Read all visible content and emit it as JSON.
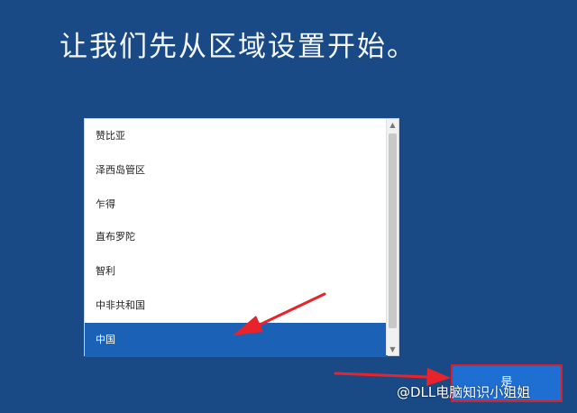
{
  "page": {
    "title": "让我们先从区域设置开始。"
  },
  "region_list": {
    "items": [
      {
        "label": "赞比亚",
        "selected": false
      },
      {
        "label": "泽西岛管区",
        "selected": false
      },
      {
        "label": "乍得",
        "selected": false
      },
      {
        "label": "直布罗陀",
        "selected": false
      },
      {
        "label": "智利",
        "selected": false
      },
      {
        "label": "中非共和国",
        "selected": false
      },
      {
        "label": "中国",
        "selected": true
      }
    ]
  },
  "scrollbar": {
    "up_icon": "chevron-up-icon",
    "down_icon": "chevron-down-icon"
  },
  "footer": {
    "next_label": "是"
  },
  "annotations": {
    "arrow_color": "#e8232a",
    "highlight_color": "#d8202a"
  },
  "watermark": {
    "text": "@DLL电脑知识小姐姐"
  },
  "colors": {
    "background": "#1a4a85",
    "selected": "#1b61b5",
    "button": "#1f6fd3"
  }
}
